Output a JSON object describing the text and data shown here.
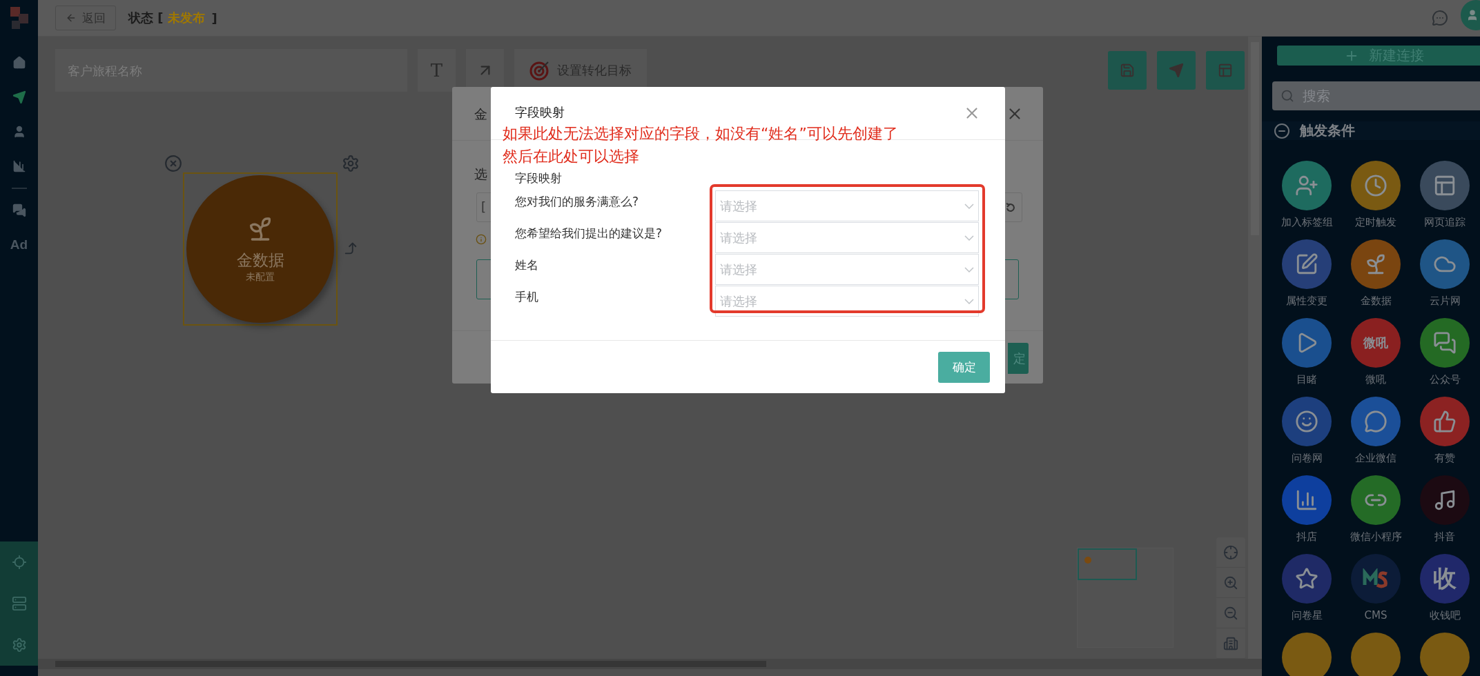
{
  "sidebar": {
    "items": [
      {
        "kind": "icon",
        "selected": false
      },
      {
        "kind": "icon",
        "selected": true
      },
      {
        "kind": "icon",
        "selected": false
      },
      {
        "kind": "icon",
        "selected": false
      },
      {
        "kind": "icon",
        "selected": false
      },
      {
        "kind": "text",
        "label": "Ad",
        "selected": false
      }
    ],
    "bottom_items": [
      {
        "kind": "icon"
      },
      {
        "kind": "icon"
      },
      {
        "kind": "icon"
      }
    ]
  },
  "header": {
    "back": "返回",
    "status": {
      "label": "状态",
      "open": "[",
      "value": "未发布",
      "close": "]"
    }
  },
  "toolbar": {
    "name_field": {
      "placeholder": "客户旅程名称"
    },
    "text_tool": "T",
    "goal_button": "设置转化目标"
  },
  "node": {
    "title": "金数据",
    "subtitle": "未配置",
    "selected": true
  },
  "palette": {
    "new_button": "新建连接",
    "search": {
      "placeholder": "搜索"
    },
    "section": {
      "title": "触发条件",
      "expanded": true
    },
    "items": [
      {
        "label": "加入标签组",
        "color": "#1e6b5f"
      },
      {
        "label": "定时触发",
        "color": "#7a5a12"
      },
      {
        "label": "网页追踪",
        "color": "#3a4a5c"
      },
      {
        "label": "属性变更",
        "color": "#263f78"
      },
      {
        "label": "金数据",
        "color": "#7a4510"
      },
      {
        "label": "云片网",
        "color": "#1f5586"
      },
      {
        "label": "目睹",
        "color": "#1a4f8e"
      },
      {
        "label": "微吼",
        "color": "#8a2020",
        "kind": "text-logo"
      },
      {
        "label": "公众号",
        "color": "#246a24"
      },
      {
        "label": "问卷网",
        "color": "#1d3f7e"
      },
      {
        "label": "企业微信",
        "color": "#1b4f98"
      },
      {
        "label": "有赞",
        "color": "#8c2222"
      },
      {
        "label": "抖店",
        "color": "#0e3f9e"
      },
      {
        "label": "微信小程序",
        "color": "#246b26"
      },
      {
        "label": "抖音",
        "color": "#1c0a12"
      },
      {
        "label": "问卷星",
        "color": "#1f2a66"
      },
      {
        "label": "CMS",
        "color": "#0c1c38"
      },
      {
        "label": "收钱吧",
        "color": "#20286a",
        "kind": "text-logo"
      },
      {
        "color": "#7a5a12"
      },
      {
        "color": "#7a5a12"
      },
      {
        "color": "#7a5a12"
      }
    ],
    "logo_texts": [
      "微吼",
      "收"
    ]
  },
  "back_dialog": {
    "title": "金",
    "label": "选",
    "value": "[",
    "button": "定"
  },
  "modal": {
    "title": "字段映射",
    "note": [
      "如果此处无法选择对应的字段，如没有“姓名”可以先创建了",
      "然后在此处可以选择"
    ],
    "section": "字段映射",
    "rows": [
      {
        "label": "您对我们的服务满意么?",
        "placeholder": "请选择"
      },
      {
        "label": "您希望给我们提出的建议是?",
        "placeholder": "请选择"
      },
      {
        "label": "姓名",
        "placeholder": "请选择"
      },
      {
        "label": "手机",
        "placeholder": "请选择"
      }
    ],
    "confirm": "确定"
  }
}
